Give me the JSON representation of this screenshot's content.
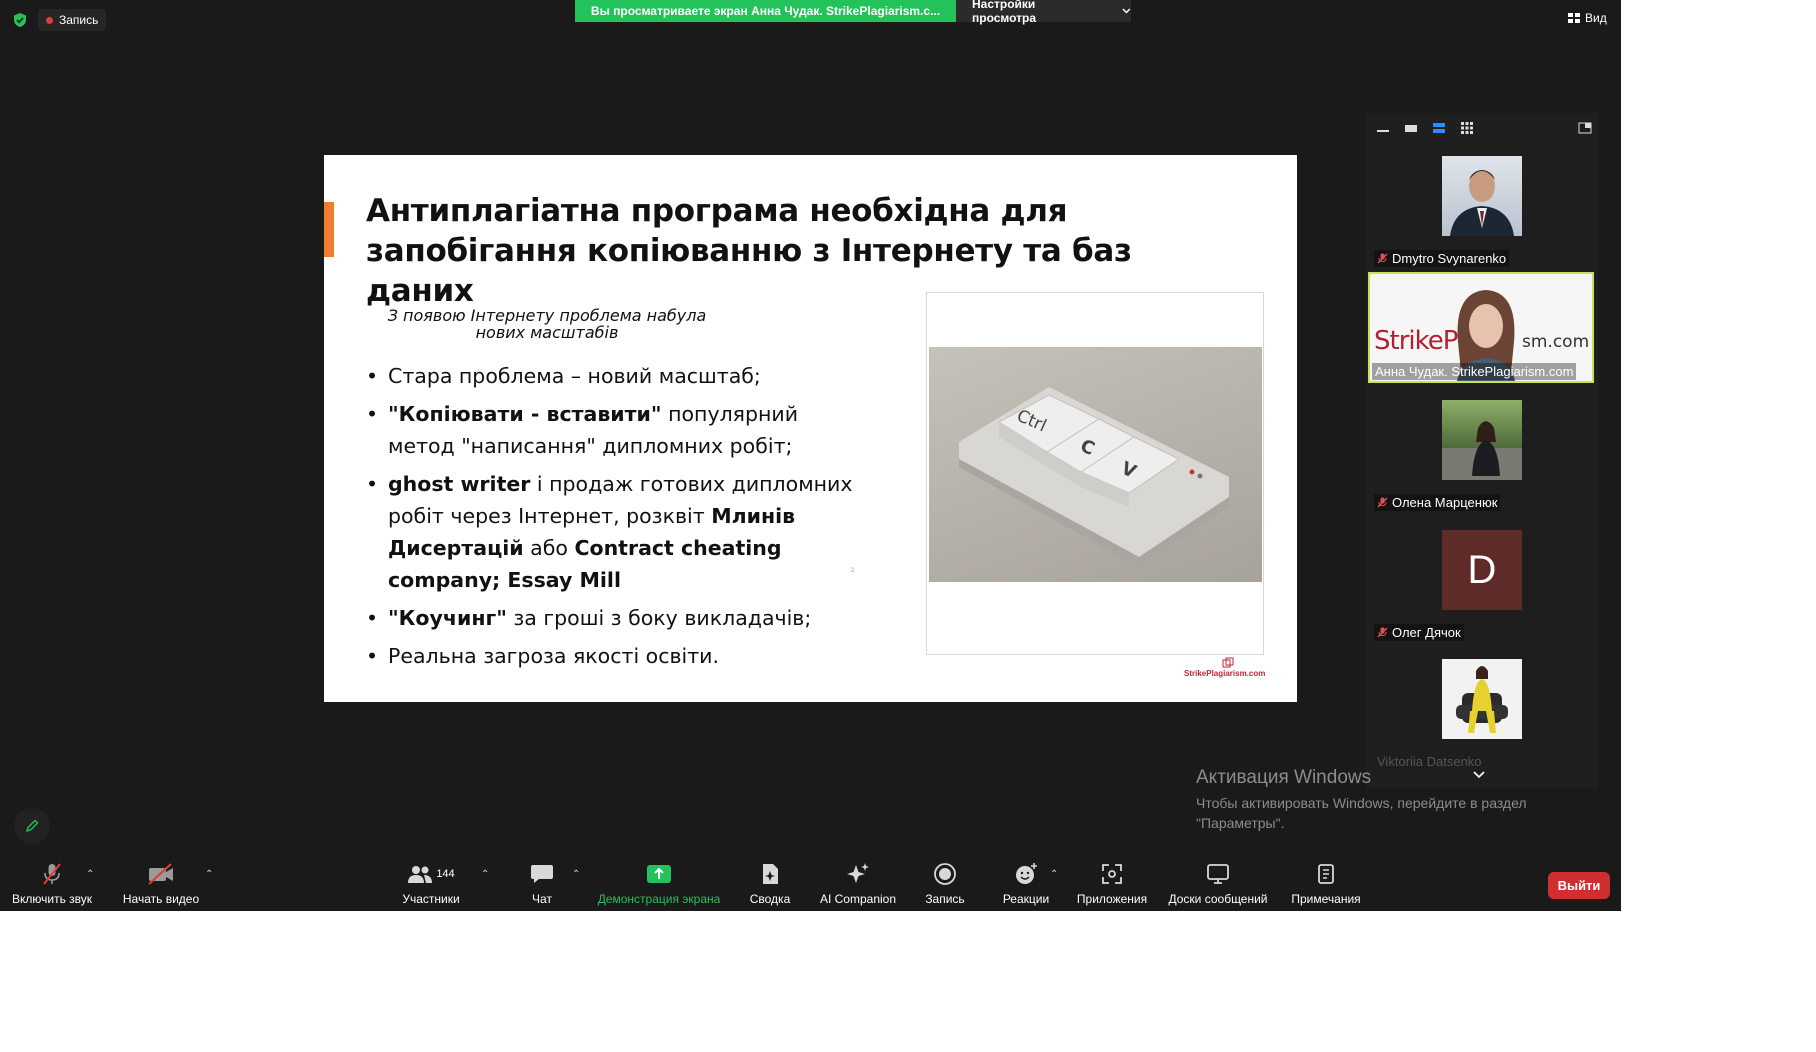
{
  "topbar": {
    "record_label": "Запись",
    "share_banner": "Вы просматриваете экран Анна Чудак. StrikePlagiarism.c...",
    "view_settings": "Настройки просмотра",
    "view_label": "Вид"
  },
  "slide": {
    "title": "Антиплагіатна програма необхідна для запобігання копіюванню з Інтернету та баз даних",
    "subtitle": "З появою Інтернету проблема набула нових масштабів",
    "bullets": {
      "b1": "Стара проблема – новий масштаб;",
      "b2_bold": "\"Копіювати - вставити\"",
      "b2_rest": " популярний метод \"написання\" дипломних робіт;",
      "b3_bold1": "ghost writer",
      "b3_mid": " і продаж готових дипломних робіт через Інтернет, розквіт ",
      "b3_bold2": "Млинів Дисертацій",
      "b3_mid2": " або ",
      "b3_bold3": "Contract cheating company; Essay Mill",
      "b4_bold": "\"Коучинг\"",
      "b4_rest": " за гроші з боку викладачів;",
      "b5": "Реальна загроза якості освіти."
    },
    "tiny_mark": "2",
    "keys": {
      "k1": "Ctrl",
      "k2": "C",
      "k3": "V"
    },
    "logo": "StrikePlagiarism.com"
  },
  "gallery": {
    "participants": [
      {
        "name": "Dmytro Svynarenko"
      },
      {
        "name": "Анна Чудак. StrikePlagiarism.com",
        "bg_text": "StrikePl",
        "bg_text2": "sm.com"
      },
      {
        "name": "Олена Марценюк"
      },
      {
        "name": "Олег Дячок",
        "initial": "D"
      },
      {
        "name": "Viktoriia Datsenko"
      }
    ]
  },
  "watermark": {
    "title": "Активация Windows",
    "text": "Чтобы активировать Windows, перейдите в раздел \"Параметры\"."
  },
  "toolbar": {
    "unmute": "Включить звук",
    "start_video": "Начать видео",
    "participants": "Участники",
    "participants_count": "144",
    "chat": "Чат",
    "share": "Демонстрация экрана",
    "summary": "Сводка",
    "ai": "AI Companion",
    "record": "Запись",
    "reactions": "Реакции",
    "apps": "Приложения",
    "whiteboards": "Доски сообщений",
    "notes": "Примечания",
    "leave": "Выйти"
  },
  "colors": {
    "share_green": "#23c25b",
    "leave_red": "#d02f2f",
    "accent_orange": "#ef7c30",
    "active_border": "#c7e252"
  }
}
